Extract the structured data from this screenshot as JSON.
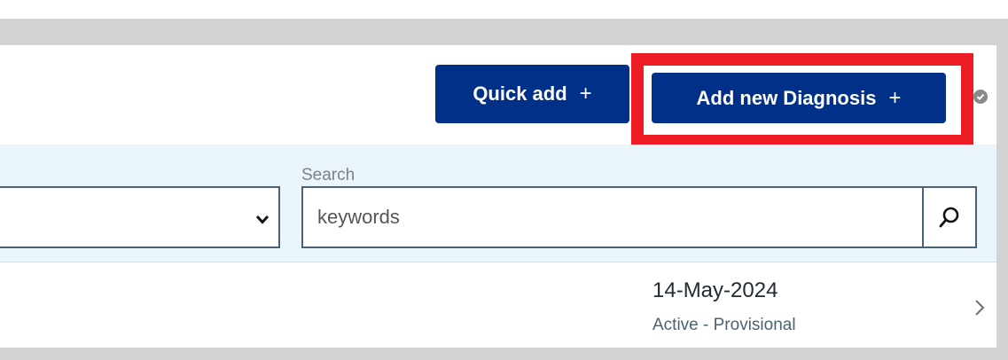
{
  "header": {
    "quick_add_label": "Quick add",
    "add_diagnosis_label": "Add new Diagnosis",
    "plus_symbol": "+"
  },
  "filters": {
    "search_label": "Search",
    "search_value": "keywords"
  },
  "diagnosis_row": {
    "date": "14-May-2024",
    "status": "Active - Provisional"
  },
  "colors": {
    "primary_button": "#003087",
    "highlight": "#ed1c24",
    "filter_background": "#eaf4fb"
  },
  "icons": {
    "select_chevron": "chevron-down-icon",
    "search": "search-icon",
    "row_chevron": "chevron-right-icon",
    "help": "help-circle-icon"
  }
}
